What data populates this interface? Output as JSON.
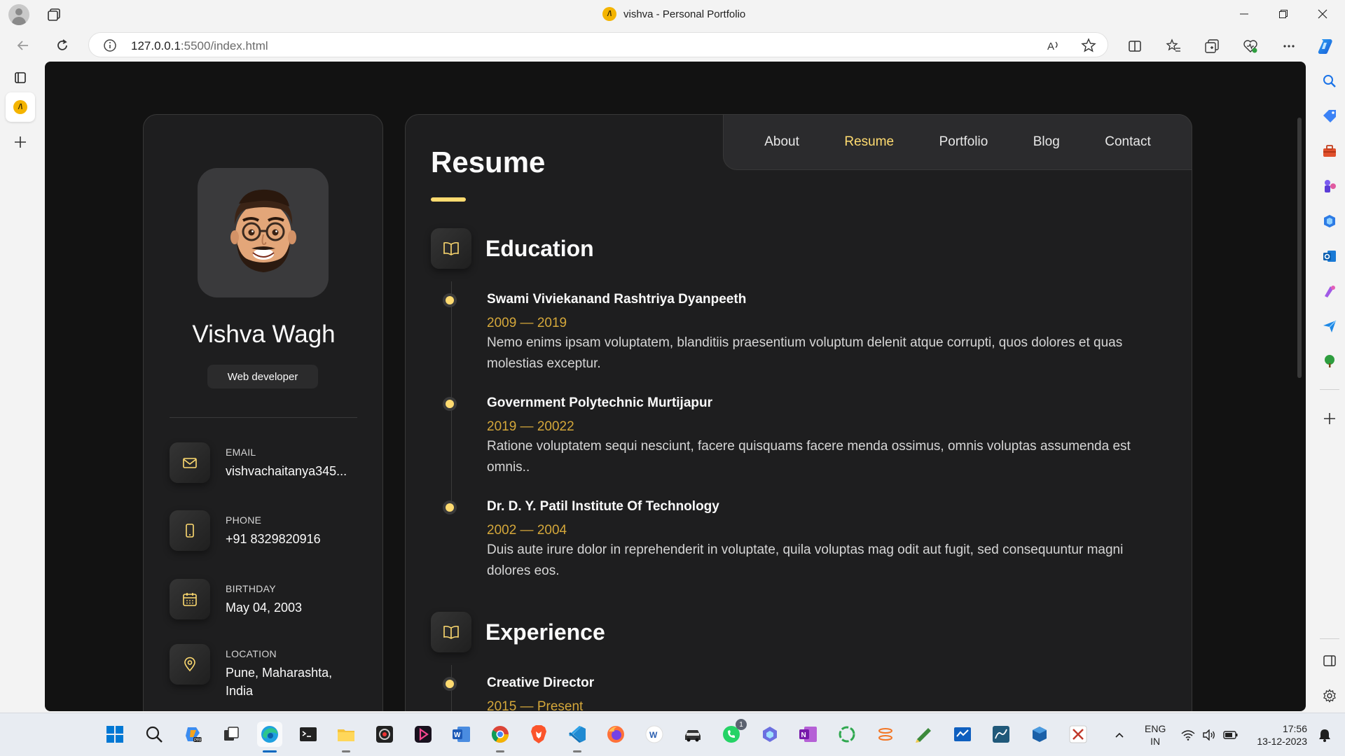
{
  "browser": {
    "window_title": "vishva - Personal Portfolio",
    "favicon_letter": "/\\",
    "url_host": "127.0.0.1",
    "url_rest": ":5500/index.html"
  },
  "profile": {
    "name": "Vishva Wagh",
    "title": "Web developer",
    "contacts": [
      {
        "label": "Email",
        "value": "vishvachaitanya345...",
        "icon": "mail-icon"
      },
      {
        "label": "Phone",
        "value": "+91 8329820916",
        "icon": "phone-icon"
      },
      {
        "label": "Birthday",
        "value": "May 04, 2003",
        "icon": "calendar-icon"
      },
      {
        "label": "Location",
        "value": "Pune, Maharashta, India",
        "icon": "location-pin-icon"
      }
    ]
  },
  "nav": {
    "items": [
      "About",
      "Resume",
      "Portfolio",
      "Blog",
      "Contact"
    ],
    "active": "Resume"
  },
  "resume": {
    "title": "Resume",
    "education": {
      "heading": "Education",
      "items": [
        {
          "title": "Swami Viviekanand Rashtriya Dyanpeeth",
          "date": "2009 — 2019",
          "text": "Nemo enims ipsam voluptatem, blanditiis praesentium voluptum delenit atque corrupti, quos dolores et quas molestias exceptur."
        },
        {
          "title": "Government Polytechnic Murtijapur",
          "date": "2019 — 20022",
          "text": "Ratione voluptatem sequi nesciunt, facere quisquams facere menda ossimus, omnis voluptas assumenda est omnis.."
        },
        {
          "title": "Dr. D. Y. Patil Institute Of Technology",
          "date": "2002 — 2004",
          "text": "Duis aute irure dolor in reprehenderit in voluptate, quila voluptas mag odit aut fugit, sed consequuntur magni dolores eos."
        }
      ]
    },
    "experience": {
      "heading": "Experience",
      "items": [
        {
          "title": "Creative Director",
          "date": "2015 — Present"
        }
      ]
    }
  },
  "taskbar": {
    "language": "ENG",
    "region": "IN",
    "time": "17:56",
    "date": "13-12-2023",
    "whatsapp_badge": "1"
  },
  "colors": {
    "accent": "#ffdb70",
    "page_bg": "#121212",
    "card_bg": "#1e1e1f"
  }
}
